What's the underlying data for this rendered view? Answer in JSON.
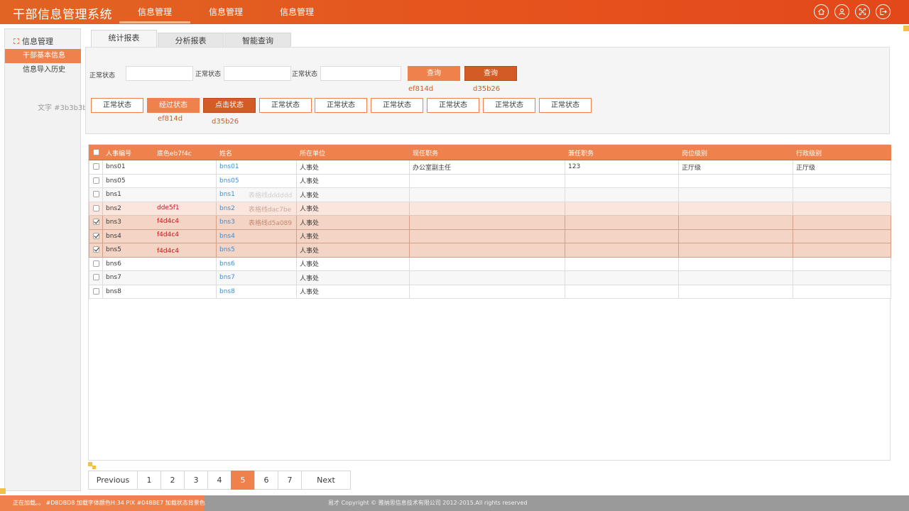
{
  "app_title": "干部信息管理系统",
  "nav": [
    "信息管理",
    "信息管理",
    "信息管理"
  ],
  "toolbar_icons": [
    "home-icon",
    "user-icon",
    "fullscreen-icon",
    "logout-icon"
  ],
  "sidebar": {
    "title": "信息管理",
    "items": [
      "干部基本信息",
      "信息导入历史"
    ],
    "note": "文字 #3b3b3b"
  },
  "tabs": [
    "统计报表",
    "分析报表",
    "智能查询"
  ],
  "query": {
    "labels": [
      "正常状态",
      "正常状态",
      "正常状态"
    ],
    "search_button": "查询",
    "search_button_pressed": "查询",
    "note_primary": "ef814d",
    "note_pressed": "d35b26"
  },
  "status_buttons": [
    "正常状态",
    "经过状态",
    "点击状态",
    "正常状态",
    "正常状态",
    "正常状态",
    "正常状态",
    "正常状态",
    "正常状态"
  ],
  "status_notes": {
    "hover": "ef814d",
    "pressed": "d35b26"
  },
  "table": {
    "columns": [
      "人事编号",
      "姓名",
      "所在单位",
      "现任职务",
      "兼任职务",
      "岗位级别",
      "行政级别"
    ],
    "header_note": "底色eb7f4c",
    "rows": [
      {
        "id": "bns01",
        "name": "bns01",
        "unit": "人事处",
        "post": "办公室副主任",
        "part_time": "123",
        "level": "正厅级",
        "admin_level": "正厅级",
        "checked": false,
        "state": "odd"
      },
      {
        "id": "bns05",
        "name": "bns05",
        "unit": "人事处",
        "post": "",
        "part_time": "",
        "level": "",
        "admin_level": "",
        "checked": false,
        "state": "odd"
      },
      {
        "id": "bns1",
        "name": "bns1",
        "unit": "人事处",
        "post": "",
        "part_time": "",
        "level": "",
        "admin_level": "",
        "checked": false,
        "state": "even"
      },
      {
        "id": "bns2",
        "name": "bns2",
        "unit": "人事处",
        "post": "",
        "part_time": "",
        "level": "",
        "admin_level": "",
        "checked": false,
        "state": "hover"
      },
      {
        "id": "bns3",
        "name": "bns3",
        "unit": "人事处",
        "post": "",
        "part_time": "",
        "level": "",
        "admin_level": "",
        "checked": true,
        "state": "selected"
      },
      {
        "id": "bns4",
        "name": "bns4",
        "unit": "人事处",
        "post": "",
        "part_time": "",
        "level": "",
        "admin_level": "",
        "checked": true,
        "state": "selected"
      },
      {
        "id": "bns5",
        "name": "bns5",
        "unit": "人事处",
        "post": "",
        "part_time": "",
        "level": "",
        "admin_level": "",
        "checked": true,
        "state": "selected"
      },
      {
        "id": "bns6",
        "name": "bns6",
        "unit": "人事处",
        "post": "",
        "part_time": "",
        "level": "",
        "admin_level": "",
        "checked": false,
        "state": "odd"
      },
      {
        "id": "bns7",
        "name": "bns7",
        "unit": "人事处",
        "post": "",
        "part_time": "",
        "level": "",
        "admin_level": "",
        "checked": false,
        "state": "even"
      },
      {
        "id": "bns8",
        "name": "bns8",
        "unit": "人事处",
        "post": "",
        "part_time": "",
        "level": "",
        "admin_level": "",
        "checked": false,
        "state": "odd"
      }
    ],
    "row_notes": [
      "dde5f1",
      "f4d4c4",
      "f4d4c4",
      "f4d4c4"
    ],
    "border_notes": [
      "表格线dddddd",
      "表格线dac7be",
      "表格线d5a089"
    ]
  },
  "pager": {
    "prev": "Previous",
    "pages": [
      "1",
      "2",
      "3",
      "4",
      "5",
      "6",
      "7"
    ],
    "current": "5",
    "next": "Next"
  },
  "footer": {
    "loading": "正在加载。。  #D8DBD8  加载字体颜色H:34 PIX #048BE7  加载状态背景色",
    "copyright": "易才 Copyright © 雅纳思信息技术有限公司 2012-2015.All rights reserved"
  },
  "colors": {
    "accent": "#ef814d",
    "pressed": "#d35b26",
    "header": "#e6521d",
    "text": "#3b3b3b",
    "link": "#3b8ed9"
  }
}
